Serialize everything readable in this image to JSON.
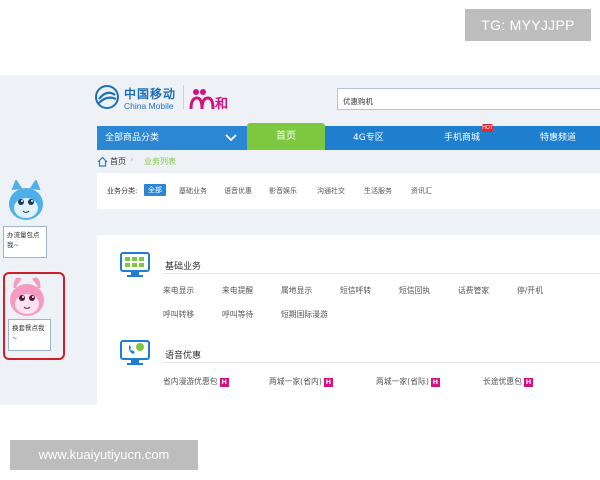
{
  "watermark": {
    "tg": "TG: MYYJJPP",
    "url": "www.kuaiyutiyucn.com"
  },
  "header": {
    "logo_cn": "中国移动",
    "logo_en": "China Mobile",
    "brand": "和",
    "search_value": "优惠购机"
  },
  "nav": {
    "category": "全部商品分类",
    "home": "首页",
    "items": [
      "4G专区",
      "手机商城",
      "特惠频道"
    ],
    "hot_badge": "HOT"
  },
  "breadcrumb": {
    "home": "首页",
    "current": "业务列表"
  },
  "filter": {
    "label": "业务分类:",
    "items": [
      "全部",
      "基础业务",
      "语音优惠",
      "影音娱乐",
      "沟通社交",
      "生活服务",
      "资讯汇"
    ]
  },
  "sections": [
    {
      "title": "基础业务",
      "links": [
        "来电显示",
        "来电提醒",
        "属地显示",
        "短信呼转",
        "短信回执",
        "话费管家",
        "停/开机",
        "呼叫转移",
        "呼叫等待",
        "短期国际漫游"
      ]
    },
    {
      "title": "语音优惠",
      "links": [
        "省内漫游优惠包",
        "两城一家(省内)",
        "两城一家(省际)",
        "长途优惠包"
      ],
      "badge": "H"
    }
  ],
  "floats": {
    "card1": "办流量包点我~",
    "card2": "换套餐点我~"
  },
  "colors": {
    "nav_blue": "#1f7fcf",
    "home_green": "#7cc83f",
    "accent_blue": "#2b86d4",
    "badge_pink": "#d3127f",
    "highlight_red": "#cc1f2b"
  }
}
